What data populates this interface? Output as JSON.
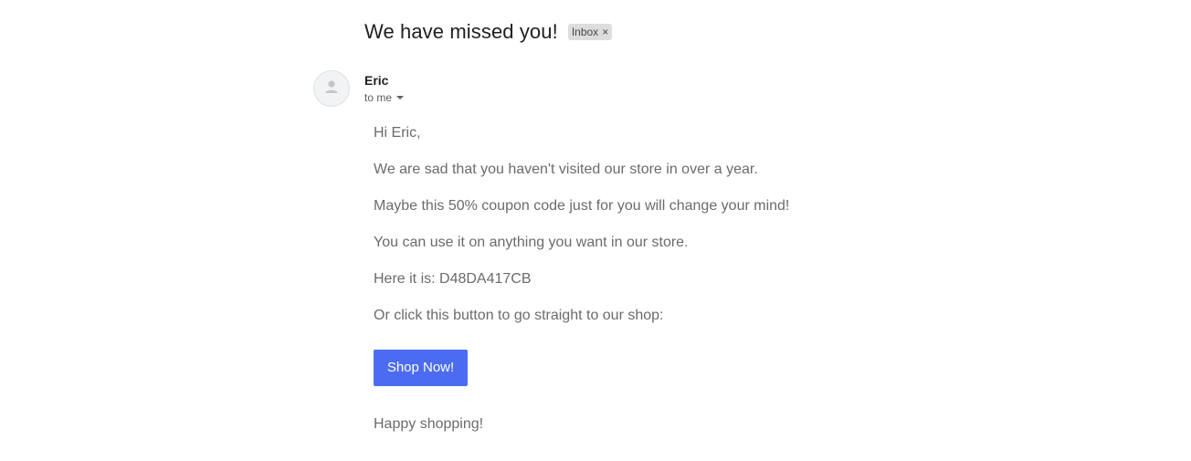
{
  "email": {
    "subject": "We have missed you!",
    "label": "Inbox",
    "label_remove": "×",
    "sender": "Eric",
    "recipient": "to me",
    "avatar_icon": "person-icon",
    "body_lines": [
      "Hi Eric,",
      "We are sad that you haven't visited our store in over a year.",
      "Maybe this 50% coupon code just for you will change your mind!",
      "You can use it on anything you want in our store.",
      "Here it is: D48DA417CB",
      "Or click this button to go straight to our shop:"
    ],
    "button_label": "Shop Now!",
    "closing": "Happy shopping!"
  },
  "colors": {
    "button": "#4b6cf0",
    "body_text": "#6b6b6b",
    "label_chip": "#dddddd"
  }
}
